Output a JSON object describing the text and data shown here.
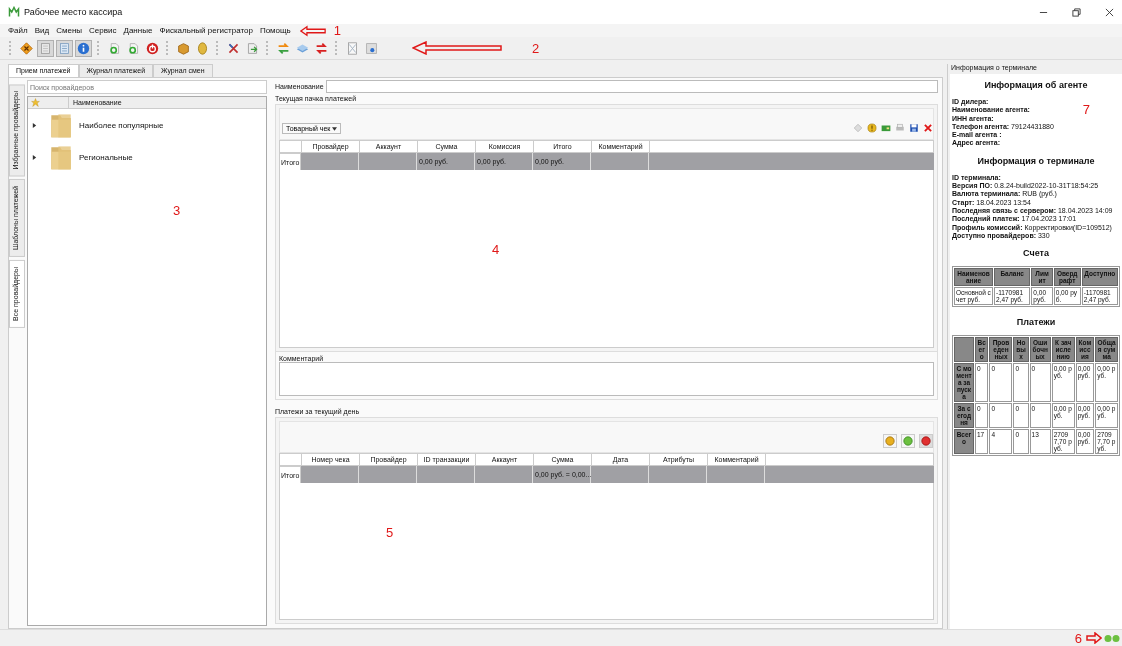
{
  "window": {
    "title": "Рабочее место кассира"
  },
  "menu": {
    "items": [
      "Файл",
      "Вид",
      "Смены",
      "Сервис",
      "Данные",
      "Фискальный регистратор",
      "Помощь"
    ],
    "annotation": "1"
  },
  "toolbar": {
    "groups": [
      [
        {
          "selected": false
        },
        {
          "selected": true
        },
        {
          "selected": true
        },
        {
          "selected": true
        }
      ],
      [
        {
          "selected": false
        },
        {
          "selected": false
        },
        {
          "selected": false
        }
      ],
      [
        {
          "selected": false
        },
        {
          "selected": false
        }
      ],
      [
        {
          "selected": false
        },
        {
          "selected": false
        }
      ],
      [
        {
          "selected": false
        },
        {
          "selected": false
        },
        {
          "selected": false
        }
      ],
      [
        {
          "selected": false
        },
        {
          "selected": false
        }
      ]
    ],
    "annotation": "2"
  },
  "tabs": [
    {
      "label": "Прием платежей",
      "selected": true
    },
    {
      "label": "Журнал платежей",
      "selected": false
    },
    {
      "label": "Журнал смен",
      "selected": false
    }
  ],
  "side_tabs": [
    {
      "label": "Избранные провайдеры",
      "selected": false
    },
    {
      "label": "Шаблоны платежей",
      "selected": false
    },
    {
      "label": "Все провайдеры",
      "selected": true
    }
  ],
  "providers": {
    "search": {
      "placeholder": "Поиск провайдеров"
    },
    "column": "Наименование",
    "items": [
      "Наиболее популярные",
      "Региональные"
    ],
    "annotation": "3"
  },
  "current_batch": {
    "name_label": "Наименование",
    "title": "Текущая пачка платежей",
    "receipt_type": "Товарный чек",
    "columns": [
      {
        "label": "Провайдер"
      },
      {
        "label": "Аккаунт"
      },
      {
        "label": "Сумма",
        "total": "0,00 руб."
      },
      {
        "label": "Комиссия",
        "total": "0,00 руб."
      },
      {
        "label": "Итого",
        "total": "0,00 руб."
      },
      {
        "label": "Комментарий"
      }
    ],
    "total_label": "Итого",
    "comment_label": "Комментарий",
    "annotation": "4"
  },
  "today": {
    "title": "Платежи за текущий день",
    "columns": [
      {
        "label": "Номер чека"
      },
      {
        "label": "Провайдер"
      },
      {
        "label": "ID транзакции"
      },
      {
        "label": "Аккаунт"
      },
      {
        "label": "Сумма",
        "total": "0,00 руб. = 0,00..."
      },
      {
        "label": "Дата"
      },
      {
        "label": "Атрибуты"
      },
      {
        "label": "Комментарий"
      }
    ],
    "total_label": "Итого",
    "annotation": "5"
  },
  "info_panel": {
    "title": "Информация о терминале",
    "agent_heading": "Информация об агенте",
    "agent_lines": [
      "**ID дилера:**",
      "**Наименование агента:**",
      "**ИНН агента:**",
      "**Телефон агента:** 79124431880",
      "**E-mail агента :**",
      "**Адрес агента:**"
    ],
    "terminal_heading": "Информация о терминале",
    "terminal_lines": [
      "**ID терминала:**",
      "**Версия ПО:** 0.8.24-build2022-10-31T18:54:25",
      "**Валюта терминала:** RUB (руб.)",
      "**Старт:** 18.04.2023 13:54",
      "**Последняя связь с сервером:** 18.04.2023 14:09",
      "**Последний платеж:** 17.04.2023 17:01",
      "**Профиль комиссий:** Корректировки(ID=109512)",
      "**Доступно провайдеров:** 330"
    ],
    "accounts": {
      "heading": "Счета",
      "columns": [
        "Наименование",
        "Баланс",
        "Лимит",
        "Овердрафт",
        "Доступно"
      ],
      "rows": [
        [
          "Основной счет руб.",
          "-11709812,47 руб.",
          "0,00 руб.",
          "0,00 руб.",
          "-11709812,47 руб."
        ]
      ]
    },
    "payments": {
      "heading": "Платежи",
      "columns": [
        "Всего",
        "Проведенных",
        "Новых",
        "Ошибочных",
        "К зачислению",
        "Комиссия",
        "Общая сумма"
      ],
      "rows": [
        {
          "label": "С момента запуска",
          "cells": [
            "0",
            "0",
            "0",
            "0",
            "0,00 руб.",
            "0,00 руб.",
            "0,00 руб."
          ]
        },
        {
          "label": "За сегодня",
          "cells": [
            "0",
            "0",
            "0",
            "0",
            "0,00 руб.",
            "0,00 руб.",
            "0,00 руб."
          ]
        },
        {
          "label": "Всего",
          "cells": [
            "17",
            "4",
            "0",
            "13",
            "27097,70 руб.",
            "0,00 руб.",
            "27097,70 руб."
          ]
        }
      ]
    },
    "annotation": "7"
  },
  "status_bar": {
    "annotation": "6"
  }
}
